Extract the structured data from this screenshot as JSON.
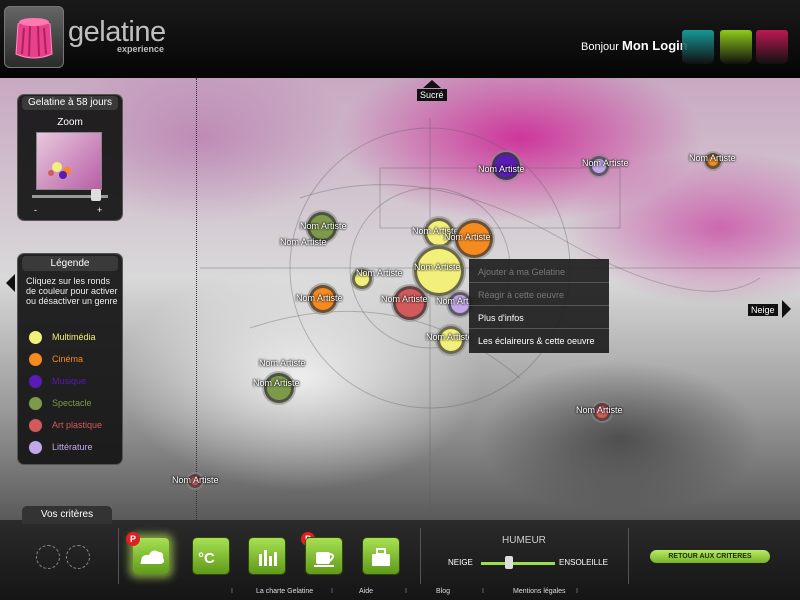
{
  "header": {
    "logo_text": "gelatine",
    "logo_sub": "experience",
    "greeting_prefix": "Bonjour",
    "login_name": "Mon Login",
    "jar_colors": [
      "#1aa6a6",
      "#9be01a",
      "#d11a5a"
    ]
  },
  "map": {
    "axis_top": "Sucré",
    "axis_right": "Neige",
    "zoom_panel": {
      "tab": "Gelatine à 58 jours",
      "label": "Zoom",
      "minus": "-",
      "plus": "+",
      "level": 0.85
    },
    "legend": {
      "tab": "Légende",
      "instructions": "Cliquez sur les ronds de couleur pour activer ou désactiver un genre",
      "items": [
        {
          "label": "Multimédia",
          "color": "#f2f07a"
        },
        {
          "label": "Cinéma",
          "color": "#f58a1f"
        },
        {
          "label": "Musique",
          "color": "#5a1ab5"
        },
        {
          "label": "Spectacle",
          "color": "#7d9a4a"
        },
        {
          "label": "Art plastique",
          "color": "#d25a5a"
        },
        {
          "label": "Littérature",
          "color": "#c2a8e8"
        }
      ]
    },
    "bubbles": [
      {
        "label": "Nom Artiste",
        "color": "#5a1ab5"
      },
      {
        "label": "Nom Artiste",
        "color": "#c2a8e8"
      },
      {
        "label": "Nom Artiste",
        "color": "#f58a1f"
      },
      {
        "label": "Nom Artiste",
        "color": "#7d9a4a"
      },
      {
        "label": "Nom Artiste",
        "color": "#f2f07a"
      },
      {
        "label": "Nom Artiste",
        "color": "#f2f07a"
      },
      {
        "label": "Nom Artiste",
        "color": "#f58a1f"
      },
      {
        "label": "Nom Artiste",
        "color": "#f2f07a"
      },
      {
        "label": "Nom Artiste",
        "color": "#f58a1f"
      },
      {
        "label": "Nom Artiste",
        "color": "#d25a5a"
      },
      {
        "label": "Nom Artiste",
        "color": "#c2a8e8"
      },
      {
        "label": "Nom Artiste",
        "color": "#f2f07a"
      },
      {
        "label": "Nom Artiste",
        "color": "#7d9a4a"
      },
      {
        "label": "Nom Artiste",
        "color": "#d25a5a"
      },
      {
        "label": "Nom Artiste",
        "color": "#d25a5a"
      }
    ],
    "context_menu": [
      {
        "label": "Ajouter à ma Gelatine",
        "enabled": false
      },
      {
        "label": "Réagir à cette oeuvre",
        "enabled": false
      },
      {
        "label": "Plus d'infos",
        "enabled": true
      },
      {
        "label": "Les éclaireurs & cette oeuvre",
        "enabled": true
      }
    ]
  },
  "footer": {
    "criteria_tab": "Vos critères",
    "criteria_icons": [
      "weather-icon",
      "temperature-icon",
      "chart-icon",
      "coffee-icon",
      "briefcase-icon"
    ],
    "badge": "P",
    "humeur": {
      "label": "HUMEUR",
      "left": "NEIGE",
      "right": "ENSOLEILLE",
      "level": 0.35
    },
    "retour_button": "RETOUR AUX CRITERES",
    "links": [
      "La charte Gelatine",
      "Aide",
      "Blog",
      "Mentions légales"
    ],
    "separator": "I"
  }
}
